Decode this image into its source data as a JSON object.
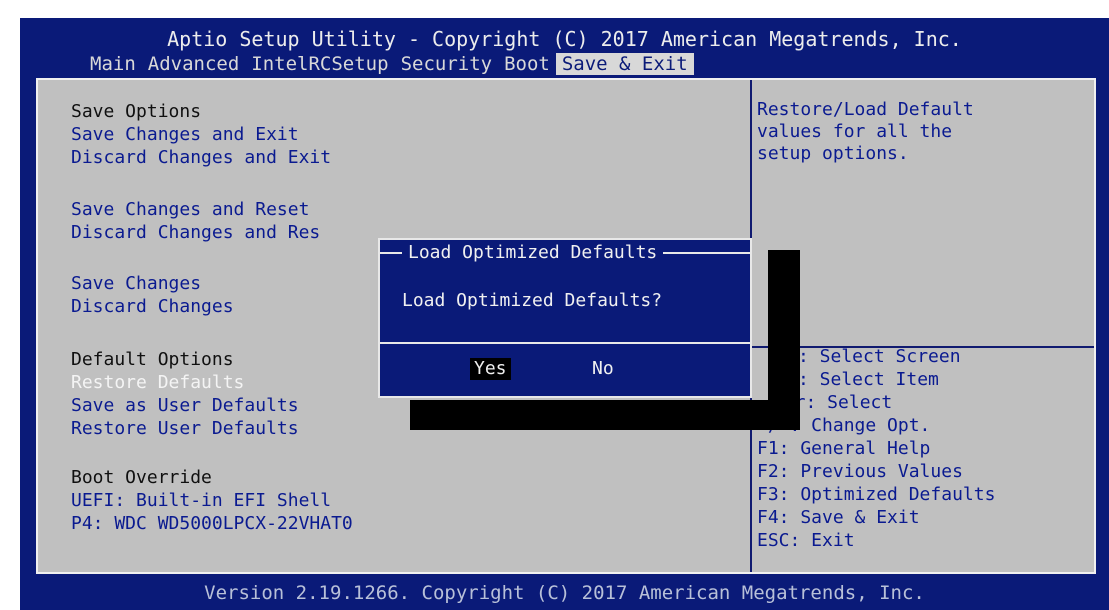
{
  "header": {
    "title": "Aptio Setup Utility - Copyright (C) 2017 American Megatrends, Inc."
  },
  "menu": {
    "tabs": [
      {
        "label": "Main"
      },
      {
        "label": "Advanced"
      },
      {
        "label": "IntelRCSetup"
      },
      {
        "label": "Security"
      },
      {
        "label": "Boot"
      },
      {
        "label": "Save & Exit"
      }
    ]
  },
  "left": {
    "save_options_header": "Save Options",
    "save_exit": "Save Changes and Exit",
    "discard_exit": "Discard Changes and Exit",
    "save_reset": "Save Changes and Reset",
    "discard_reset": "Discard Changes and Res",
    "save_changes": "Save Changes",
    "discard_changes": "Discard Changes",
    "default_options_header": "Default Options",
    "restore_defaults": "Restore Defaults",
    "save_user_defaults": "Save as User Defaults",
    "restore_user_defaults": "Restore User Defaults",
    "boot_override_header": "Boot Override",
    "boot_uefi": "UEFI: Built-in EFI Shell",
    "boot_p4": "P4: WDC WD5000LPCX-22VHAT0"
  },
  "help": {
    "description": [
      "Restore/Load Default",
      "values for all the",
      "setup options."
    ],
    "keys": [
      ": Select Screen",
      ": Select Item",
      "ter: Select",
      "+/-: Change Opt.",
      "F1: General Help",
      "F2: Previous Values",
      "F3: Optimized Defaults",
      "F4: Save & Exit",
      "ESC: Exit"
    ]
  },
  "dialog": {
    "title": "Load Optimized Defaults",
    "message": "Load Optimized Defaults?",
    "yes": "Yes",
    "no": "No"
  },
  "footer": {
    "text": "Version 2.19.1266. Copyright (C) 2017 American Megatrends, Inc."
  }
}
